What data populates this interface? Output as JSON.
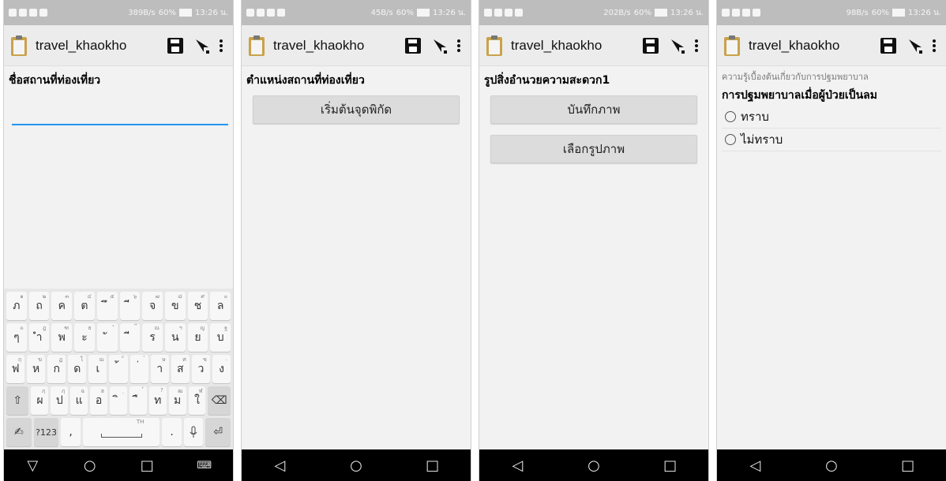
{
  "status": {
    "speeds": [
      "389B/s",
      "45B/s",
      "202B/s",
      "98B/s"
    ],
    "battery": "60%",
    "time": "13:26 น."
  },
  "app": {
    "title": "travel_khaokho"
  },
  "screens": {
    "s1": {
      "question": "ชื่อสถานที่ท่องเที่ยว",
      "input_value": ""
    },
    "s2": {
      "question": "ตำแหน่งสถานที่ท่องเที่ยว",
      "button": "เริ่มต้นจุดพิกัด"
    },
    "s3": {
      "question": "รูปสิ่งอำนวยความสะดวก1",
      "button1": "บันทึกภาพ",
      "button2": "เลือกรูปภาพ"
    },
    "s4": {
      "group": "ความรู้เบื้องต้นเกี่ยวกับการปฐมพยาบาล",
      "question": "การปฐมพยาบาลเมื่อผู้ป่วยเป็นลม",
      "options": [
        "ทราบ",
        "ไม่ทราบ"
      ]
    }
  },
  "keyboard": {
    "row1": [
      [
        "ภ",
        "๑"
      ],
      [
        "ถ",
        "๒"
      ],
      [
        "ค",
        "๓"
      ],
      [
        "ต",
        "๔"
      ],
      [
        "ึ",
        "๕"
      ],
      [
        "ี",
        "๖"
      ],
      [
        "จ",
        "๗"
      ],
      [
        "ข",
        "๘"
      ],
      [
        "ช",
        "๙"
      ],
      [
        "ล",
        "๐"
      ]
    ],
    "row2": [
      [
        "ๆ",
        "๏"
      ],
      [
        "ำ",
        "ฎ"
      ],
      [
        "พ",
        "ฑ"
      ],
      [
        "ะ",
        "ธ"
      ],
      [
        "ั",
        "ํ"
      ],
      [
        "ี",
        "๊"
      ],
      [
        "ร",
        "ณ"
      ],
      [
        "น",
        "ฯ"
      ],
      [
        "ย",
        "ญ"
      ],
      [
        "บ",
        "ฐ"
      ]
    ],
    "row3": [
      [
        "ฟ",
        "ฤ"
      ],
      [
        "ห",
        "ฆ"
      ],
      [
        "ก",
        "ฏ"
      ],
      [
        "ด",
        "โ"
      ],
      [
        "เ",
        "ฌ"
      ],
      [
        "้",
        "็"
      ],
      [
        "่",
        "๋"
      ],
      [
        "า",
        "ษ"
      ],
      [
        "ส",
        "ศ"
      ],
      [
        "ว",
        "ซ"
      ],
      [
        "ง",
        "."
      ]
    ],
    "row4": [
      [
        "ผ",
        "ฦ"
      ],
      [
        "ป",
        "ฦ"
      ],
      [
        "แ",
        "ฉ"
      ],
      [
        "อ",
        "ฮ"
      ],
      [
        "ิ",
        "ฺ"
      ],
      [
        "ื",
        "์"
      ],
      [
        "ท",
        "?"
      ],
      [
        "ม",
        "ฒ"
      ],
      [
        "ใ",
        "ฬ"
      ]
    ],
    "mode_key": "?123",
    "space_hint": "TH",
    "punct": [
      ",",
      "."
    ]
  },
  "colors": {
    "accent": "#2196f3",
    "navbar": "#000000",
    "appbar": "#ececec",
    "statusbar": "#bdbdbd"
  }
}
